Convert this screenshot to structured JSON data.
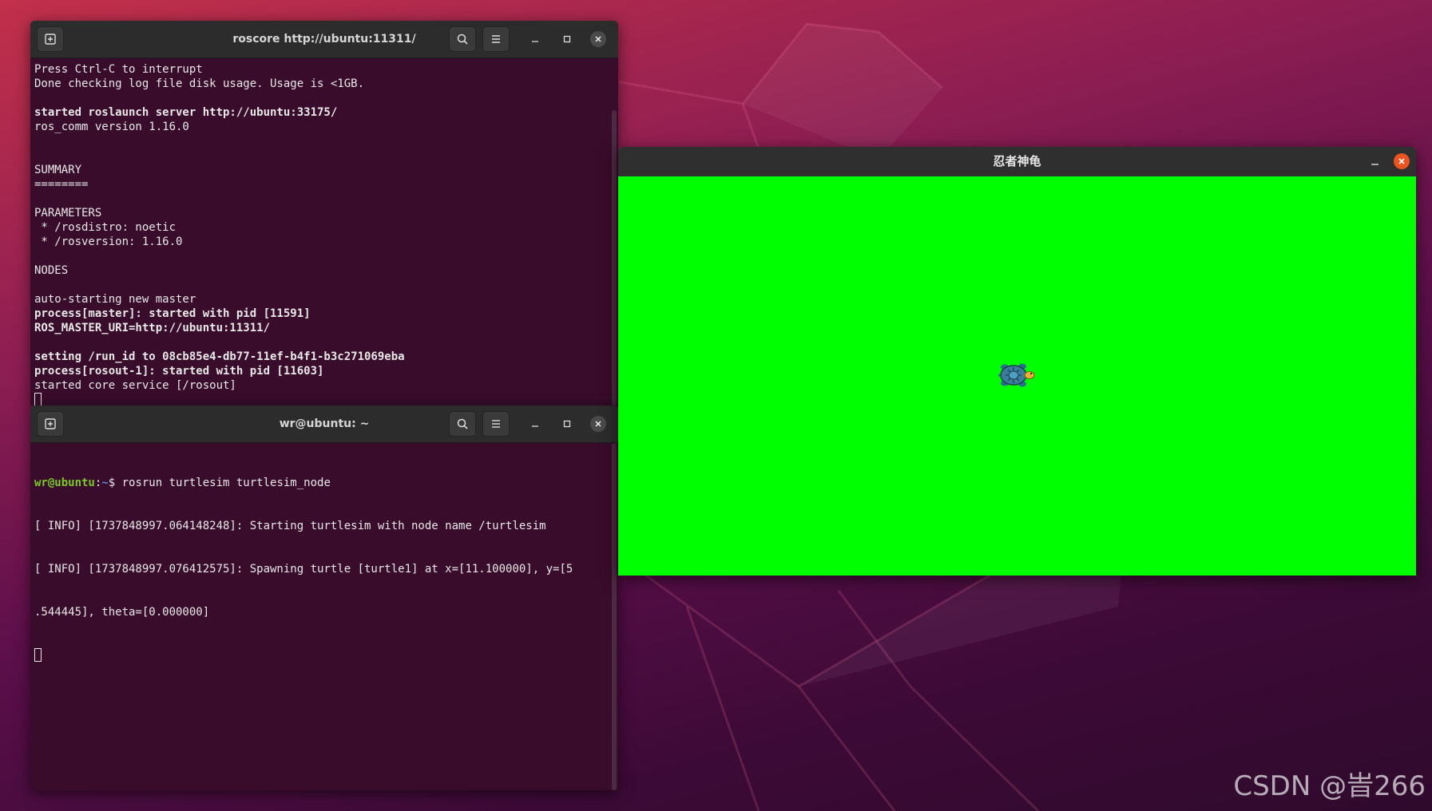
{
  "terminal1": {
    "title": "roscore http://ubuntu:11311/",
    "lines": [
      {
        "text": "Press Ctrl-C to interrupt",
        "bold": false
      },
      {
        "text": "Done checking log file disk usage. Usage is <1GB.",
        "bold": false
      },
      {
        "text": "",
        "bold": false
      },
      {
        "text": "started roslaunch server http://ubuntu:33175/",
        "bold": true
      },
      {
        "text": "ros_comm version 1.16.0",
        "bold": false
      },
      {
        "text": "",
        "bold": false
      },
      {
        "text": "",
        "bold": false
      },
      {
        "text": "SUMMARY",
        "bold": false
      },
      {
        "text": "========",
        "bold": false
      },
      {
        "text": "",
        "bold": false
      },
      {
        "text": "PARAMETERS",
        "bold": false
      },
      {
        "text": " * /rosdistro: noetic",
        "bold": false
      },
      {
        "text": " * /rosversion: 1.16.0",
        "bold": false
      },
      {
        "text": "",
        "bold": false
      },
      {
        "text": "NODES",
        "bold": false
      },
      {
        "text": "",
        "bold": false
      },
      {
        "text": "auto-starting new master",
        "bold": false
      },
      {
        "text": "process[master]: started with pid [11591]",
        "bold": true
      },
      {
        "text": "ROS_MASTER_URI=http://ubuntu:11311/",
        "bold": true
      },
      {
        "text": "",
        "bold": false
      },
      {
        "text": "setting /run_id to 08cb85e4-db77-11ef-b4f1-b3c271069eba",
        "bold": true
      },
      {
        "text": "process[rosout-1]: started with pid [11603]",
        "bold": true
      },
      {
        "text": "started core service [/rosout]",
        "bold": false
      }
    ]
  },
  "terminal2": {
    "title": "wr@ubuntu: ~",
    "prompt_user": "wr@ubuntu",
    "prompt_sep": ":",
    "prompt_path": "~",
    "prompt_symbol": "$ ",
    "command": "rosrun turtlesim turtlesim_node",
    "output": [
      "[ INFO] [1737848997.064148248]: Starting turtlesim with node name /turtlesim",
      "[ INFO] [1737848997.076412575]: Spawning turtle [turtle1] at x=[11.100000], y=[5",
      ".544445], theta=[0.000000]"
    ]
  },
  "turtlesim": {
    "title": "忍者神龟",
    "background": "#00ff00",
    "turtle_name": "turtle1"
  },
  "watermark": "CSDN @旹266",
  "icons": {
    "new_tab": "new-tab-icon",
    "search": "search-icon",
    "menu": "hamburger-menu-icon",
    "minimize": "minimize-icon",
    "maximize": "maximize-icon",
    "close": "close-icon"
  }
}
